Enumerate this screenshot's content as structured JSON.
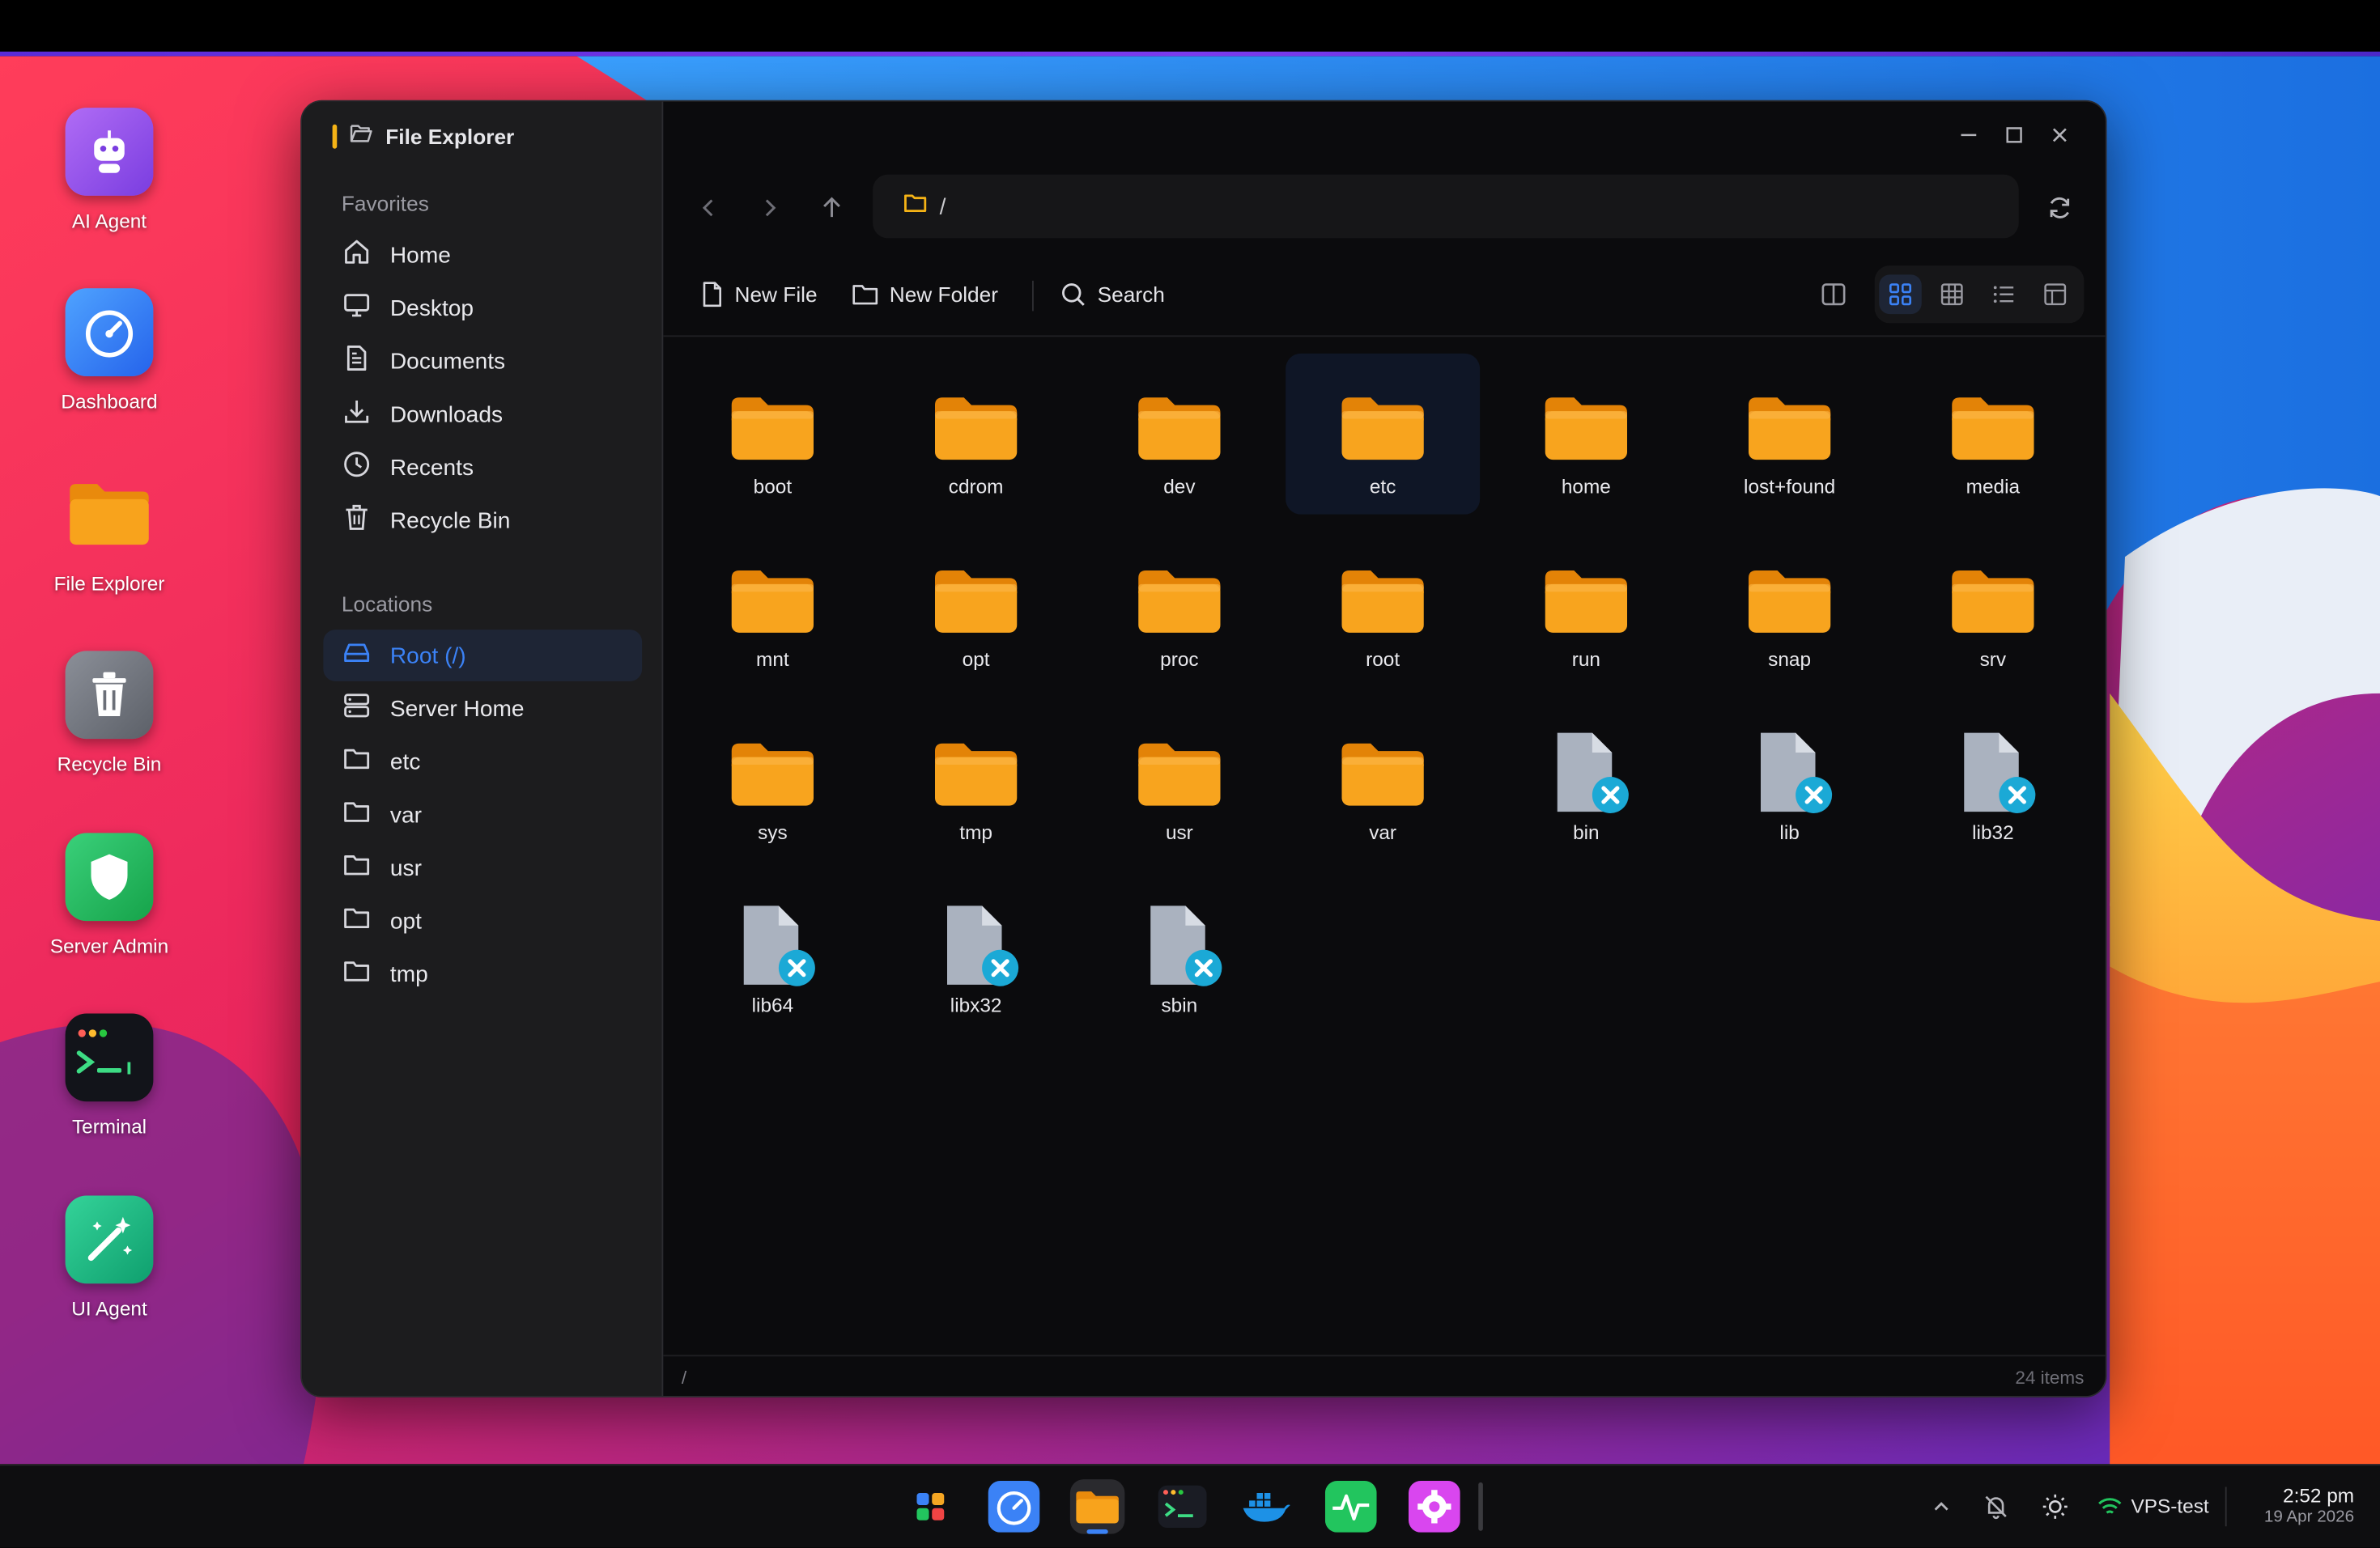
{
  "desktop": {
    "icons": [
      {
        "label": "AI Agent",
        "icon": "robot-icon"
      },
      {
        "label": "Dashboard",
        "icon": "speedometer-icon"
      },
      {
        "label": "File Explorer",
        "icon": "folder-icon"
      },
      {
        "label": "Recycle Bin",
        "icon": "trash-icon"
      },
      {
        "label": "Server Admin",
        "icon": "shield-icon"
      },
      {
        "label": "Terminal",
        "icon": "terminal-icon"
      },
      {
        "label": "UI Agent",
        "icon": "magic-wand-icon"
      }
    ]
  },
  "window": {
    "title": "File Explorer",
    "sidebar": {
      "favorites_label": "Favorites",
      "favorites": [
        {
          "label": "Home",
          "icon": "home-icon"
        },
        {
          "label": "Desktop",
          "icon": "monitor-icon"
        },
        {
          "label": "Documents",
          "icon": "document-icon"
        },
        {
          "label": "Downloads",
          "icon": "download-icon"
        },
        {
          "label": "Recents",
          "icon": "clock-icon"
        },
        {
          "label": "Recycle Bin",
          "icon": "trash-icon"
        }
      ],
      "locations_label": "Locations",
      "locations": [
        {
          "label": "Root (/)",
          "icon": "drive-icon",
          "active": true
        },
        {
          "label": "Server Home",
          "icon": "server-icon"
        },
        {
          "label": "etc",
          "icon": "folder-icon"
        },
        {
          "label": "var",
          "icon": "folder-icon"
        },
        {
          "label": "usr",
          "icon": "folder-icon"
        },
        {
          "label": "opt",
          "icon": "folder-icon"
        },
        {
          "label": "tmp",
          "icon": "folder-icon"
        }
      ]
    },
    "address": {
      "path": "/"
    },
    "toolbar": {
      "new_file": "New File",
      "new_folder": "New Folder",
      "search": "Search"
    },
    "items": [
      {
        "name": "boot",
        "type": "folder"
      },
      {
        "name": "cdrom",
        "type": "folder"
      },
      {
        "name": "dev",
        "type": "folder"
      },
      {
        "name": "etc",
        "type": "folder",
        "selected": true
      },
      {
        "name": "home",
        "type": "folder"
      },
      {
        "name": "lost+found",
        "type": "folder"
      },
      {
        "name": "media",
        "type": "folder"
      },
      {
        "name": "mnt",
        "type": "folder"
      },
      {
        "name": "opt",
        "type": "folder"
      },
      {
        "name": "proc",
        "type": "folder"
      },
      {
        "name": "root",
        "type": "folder"
      },
      {
        "name": "run",
        "type": "folder"
      },
      {
        "name": "snap",
        "type": "folder"
      },
      {
        "name": "srv",
        "type": "folder"
      },
      {
        "name": "sys",
        "type": "folder"
      },
      {
        "name": "tmp",
        "type": "folder"
      },
      {
        "name": "usr",
        "type": "folder"
      },
      {
        "name": "var",
        "type": "folder"
      },
      {
        "name": "bin",
        "type": "broken-link"
      },
      {
        "name": "lib",
        "type": "broken-link"
      },
      {
        "name": "lib32",
        "type": "broken-link"
      },
      {
        "name": "lib64",
        "type": "broken-link"
      },
      {
        "name": "libx32",
        "type": "broken-link"
      },
      {
        "name": "sbin",
        "type": "broken-link"
      }
    ],
    "status": {
      "path": "/",
      "count": "24 items"
    }
  },
  "taskbar": {
    "apps": [
      "start-menu-icon",
      "dashboard-icon",
      "file-explorer-icon",
      "terminal-icon",
      "docker-icon",
      "activity-monitor-icon",
      "settings-icon"
    ],
    "network_name": "VPS-test",
    "time": "2:52 pm",
    "date": "19 Apr 2026"
  },
  "colors": {
    "accent": "#3b82f6",
    "folder": "#f5a623",
    "broken_badge": "#1ba9d6"
  }
}
